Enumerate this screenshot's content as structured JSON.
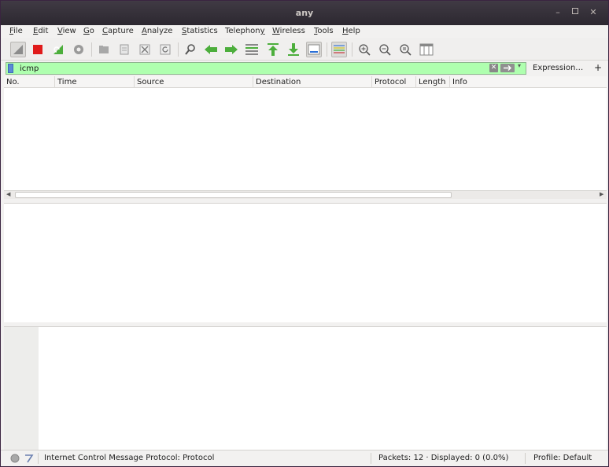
{
  "window": {
    "title": "any"
  },
  "menu": {
    "items": [
      {
        "label": "File",
        "ul": "F",
        "rest": "ile"
      },
      {
        "label": "Edit",
        "ul": "E",
        "rest": "dit"
      },
      {
        "label": "View",
        "ul": "V",
        "rest": "iew"
      },
      {
        "label": "Go",
        "ul": "G",
        "rest": "o"
      },
      {
        "label": "Capture",
        "ul": "C",
        "rest": "apture"
      },
      {
        "label": "Analyze",
        "ul": "A",
        "rest": "nalyze"
      },
      {
        "label": "Statistics",
        "ul": "S",
        "rest": "tatistics"
      },
      {
        "label": "Telephony",
        "pre": "Telephon",
        "ul": "y",
        "rest": ""
      },
      {
        "label": "Wireless",
        "ul": "W",
        "rest": "ireless"
      },
      {
        "label": "Tools",
        "ul": "T",
        "rest": "ools"
      },
      {
        "label": "Help",
        "ul": "H",
        "rest": "elp"
      }
    ]
  },
  "filter": {
    "value": "icmp",
    "expression_label": "Expression…",
    "add_label": "+"
  },
  "columns": [
    "No.",
    "Time",
    "Source",
    "Destination",
    "Protocol",
    "Length",
    "Info"
  ],
  "status": {
    "field_info": "Internet Control Message Protocol: Protocol",
    "packets": "Packets: 12 · Displayed: 0 (0.0%)",
    "profile": "Profile: Default"
  },
  "colors": {
    "filter_valid_bg": "#afffaf",
    "capture_stop": "#e01b1b",
    "go_arrow": "#4cae3c"
  }
}
